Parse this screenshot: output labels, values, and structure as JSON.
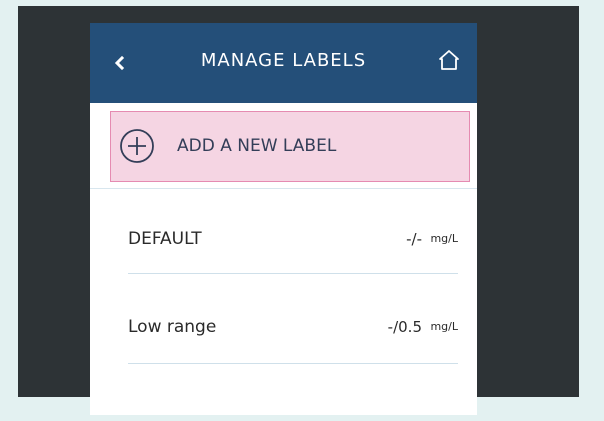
{
  "header": {
    "title": "MANAGE LABELS",
    "back_icon": "chevron-left-icon",
    "home_icon": "home-icon",
    "background_color": "#244f79"
  },
  "add_label": {
    "label": "ADD A NEW LABEL",
    "icon": "plus-circle-icon",
    "highlight_color": "#f5d5e3",
    "highlight_border": "#e58bb1"
  },
  "labels": [
    {
      "name": "DEFAULT",
      "value": "-/-",
      "unit": "mg/L"
    },
    {
      "name": "Low range",
      "value": "-/0.5",
      "unit": "mg/L"
    }
  ]
}
